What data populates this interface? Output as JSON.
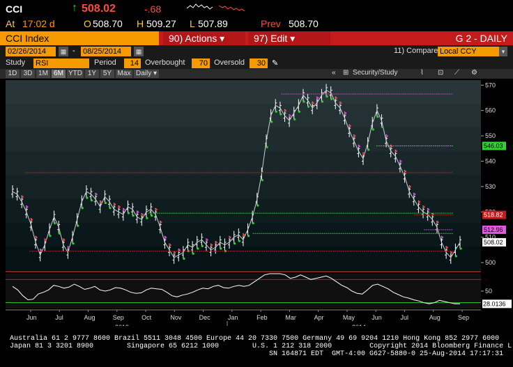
{
  "quote": {
    "ticker": "CCI",
    "arrow": "↑",
    "last": "508.02",
    "change": "-.68",
    "at_label": "At",
    "time": "17:02 d",
    "open_label": "O",
    "open": "508.70",
    "high_label": "H",
    "high": "509.27",
    "low_label": "L",
    "low": "507.89",
    "prev_label": "Prev",
    "prev": "508.70"
  },
  "cmd_bar": {
    "index_label": "CCI Index",
    "actions_label": "90) Actions ▾",
    "edit_label": "97) Edit ▾",
    "chart_label": "G 2 - DAILY"
  },
  "date_range": {
    "start": "02/26/2014",
    "separator": "-",
    "end": "08/25/2014",
    "compare_label": "11) Compare",
    "compare_value": "Local CCY"
  },
  "study": {
    "study_label": "Study",
    "study_value": "RSI",
    "period_label": "Period",
    "period_value": "14",
    "overbought_label": "Overbought",
    "overbought_value": "70",
    "oversold_label": "Oversold",
    "oversold_value": "30"
  },
  "periods": [
    "1D",
    "3D",
    "1M",
    "6M",
    "YTD",
    "1Y",
    "5Y",
    "Max",
    "Daily ▾"
  ],
  "active_period": "6M",
  "toolbar": {
    "security_study": "Security/Study"
  },
  "chart_data": {
    "type": "line",
    "price_panel": {
      "y_ticks": [
        500,
        510,
        520,
        530,
        540,
        550,
        560,
        570
      ],
      "ylim": [
        497,
        572
      ],
      "price_labels": {
        "current": "508.02",
        "red": "518.82",
        "pink": "512.96",
        "green": "546.03"
      }
    },
    "rsi_panel": {
      "y_ticks": [
        50
      ],
      "current_label": "28.0136",
      "ylim": [
        20,
        80
      ]
    },
    "x_months": [
      "Jun",
      "Jul",
      "Aug",
      "Sep",
      "Oct",
      "Nov",
      "Dec",
      "Jan",
      "Feb",
      "Mar",
      "Apr",
      "May",
      "Jun",
      "Jul",
      "Aug",
      "Sep"
    ],
    "x_years": [
      "2013",
      "2014"
    ],
    "price_series": [
      528,
      527,
      524,
      520,
      515,
      508,
      503,
      507,
      513,
      518,
      514,
      507,
      504,
      510,
      517,
      524,
      528,
      527,
      525,
      522,
      526,
      524,
      521,
      520,
      519,
      522,
      521,
      518,
      517,
      520,
      521,
      519,
      514,
      508,
      505,
      502,
      503,
      504,
      507,
      506,
      508,
      509,
      507,
      505,
      506,
      508,
      507,
      508,
      510,
      511,
      509,
      513,
      518,
      525,
      535,
      548,
      558,
      562,
      561,
      558,
      556,
      559,
      562,
      566,
      564,
      561,
      563,
      566,
      568,
      567,
      563,
      561,
      557,
      552,
      548,
      544,
      541,
      547,
      555,
      560,
      556,
      548,
      544,
      542,
      538,
      534,
      528,
      525,
      522,
      520,
      519,
      517,
      514,
      508,
      504,
      502,
      505,
      508
    ],
    "rsi_series": [
      58,
      52,
      42,
      35,
      36,
      45,
      48,
      52,
      60,
      58,
      55,
      57,
      62,
      58,
      53,
      55,
      58,
      52,
      50,
      52,
      56,
      55,
      52,
      48,
      46,
      47,
      52,
      55,
      54,
      53,
      48,
      42,
      40,
      43,
      45,
      48,
      52,
      55,
      54,
      58,
      60,
      56,
      55,
      58,
      60,
      58,
      60,
      66,
      72,
      78,
      82,
      86,
      84,
      78,
      72,
      74,
      78,
      74,
      70,
      72,
      74,
      76,
      72,
      66,
      60,
      56,
      50,
      46,
      45,
      52,
      60,
      62,
      58,
      54,
      48,
      44,
      40,
      38,
      35,
      33,
      30,
      28,
      30,
      34,
      32,
      30,
      28,
      28
    ]
  },
  "footer": {
    "line1": "Australia 61 2 9777 8600 Brazil 5511 3048 4500 Europe 44 20 7330 7500 Germany 49 69 9204 1210 Hong Kong 852 2977 6000",
    "line2": "Japan 81 3 3201 8900        Singapore 65 6212 1000        U.S. 1 212 318 2000         Copyright 2014 Bloomberg Finance L.P.",
    "line3": "SN 164871 EDT  GMT-4:00 G627-5880-0 25-Aug-2014 17:17:31"
  },
  "colors": {
    "accent_orange": "#f59b00",
    "bar_red": "#c41b1b",
    "up_green": "#2fd12f",
    "down_red": "#ff4a3d"
  }
}
